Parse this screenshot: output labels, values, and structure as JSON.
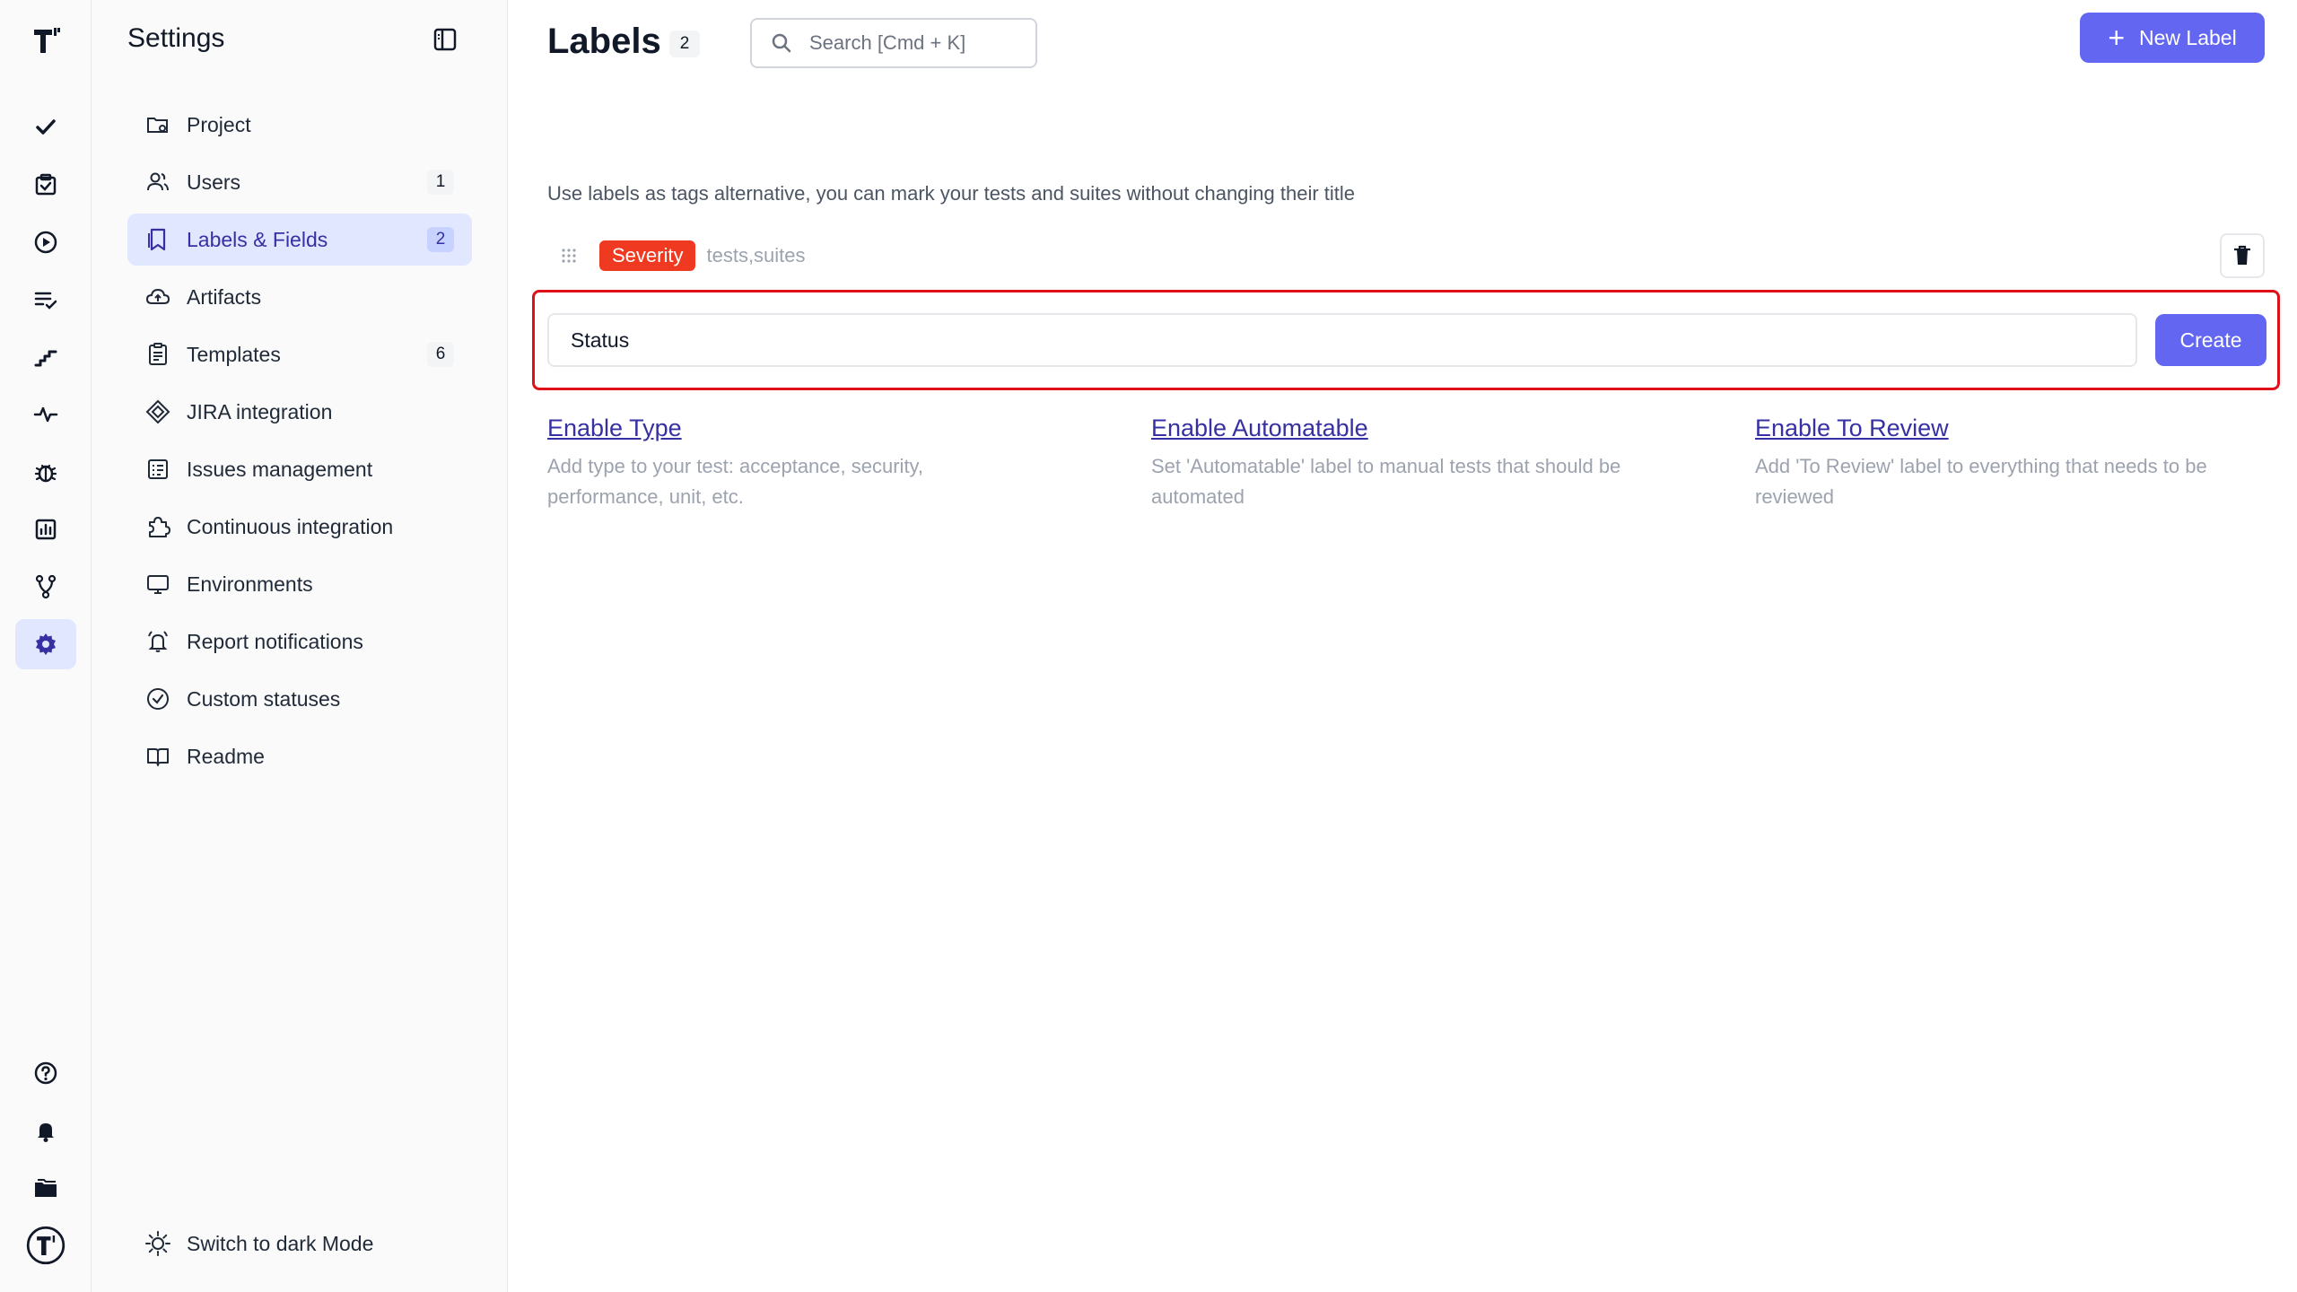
{
  "rail": {
    "items": [
      {
        "icon": "check-icon",
        "name": "tests"
      },
      {
        "icon": "clipboard-check-icon",
        "name": "plans"
      },
      {
        "icon": "play-circle-icon",
        "name": "runs"
      },
      {
        "icon": "list-check-icon",
        "name": "milestones"
      },
      {
        "icon": "steps-icon",
        "name": "steps"
      },
      {
        "icon": "pulse-icon",
        "name": "pulse"
      },
      {
        "icon": "bug-icon",
        "name": "defects"
      },
      {
        "icon": "analytics-icon",
        "name": "analytics"
      },
      {
        "icon": "branches-icon",
        "name": "branches"
      },
      {
        "icon": "gear-icon",
        "name": "settings",
        "active": true
      }
    ],
    "bottom": [
      {
        "icon": "help-icon"
      },
      {
        "icon": "bell-icon"
      },
      {
        "icon": "folder-icon"
      },
      {
        "icon": "logo-avatar-icon"
      }
    ]
  },
  "settings": {
    "title": "Settings",
    "items": [
      {
        "label": "Project",
        "icon": "folder-gear-icon",
        "count": ""
      },
      {
        "label": "Users",
        "icon": "users-icon",
        "count": "1"
      },
      {
        "label": "Labels & Fields",
        "icon": "bookmark-icon",
        "count": "2",
        "active": true
      },
      {
        "label": "Artifacts",
        "icon": "cloud-icon",
        "count": ""
      },
      {
        "label": "Templates",
        "icon": "document-icon",
        "count": "6"
      },
      {
        "label": "JIRA integration",
        "icon": "jira-icon",
        "count": ""
      },
      {
        "label": "Issues management",
        "icon": "issues-icon",
        "count": ""
      },
      {
        "label": "Continuous integration",
        "icon": "puzzle-icon",
        "count": ""
      },
      {
        "label": "Environments",
        "icon": "monitor-icon",
        "count": ""
      },
      {
        "label": "Report notifications",
        "icon": "bell-ring-icon",
        "count": ""
      },
      {
        "label": "Custom statuses",
        "icon": "check-circle-icon",
        "count": ""
      },
      {
        "label": "Readme",
        "icon": "book-icon",
        "count": ""
      }
    ],
    "dark_mode_label": "Switch to dark Mode"
  },
  "header": {
    "title": "Labels",
    "count": "2",
    "search_placeholder": "Search [Cmd + K]",
    "new_label": "New Label"
  },
  "main": {
    "description": "Use labels as tags alternative, you can mark your tests and suites without changing their title",
    "labels": [
      {
        "name": "Severity",
        "color": "#ef3a21",
        "scope": "tests,suites"
      }
    ],
    "new_label_input": "Status",
    "create_label": "Create",
    "suggestions": [
      {
        "title": "Enable Type",
        "description": "Add type to your test: acceptance, security, performance, unit, etc."
      },
      {
        "title": "Enable Automatable",
        "description": "Set 'Automatable' label to manual tests that should be automated"
      },
      {
        "title": "Enable To Review",
        "description": "Add 'To Review' label to everything that needs to be reviewed"
      }
    ]
  },
  "colors": {
    "accent": "#6366f1",
    "active_bg": "#e0e7ff",
    "highlight_frame": "#e0101a",
    "severity": "#ef3a21"
  }
}
